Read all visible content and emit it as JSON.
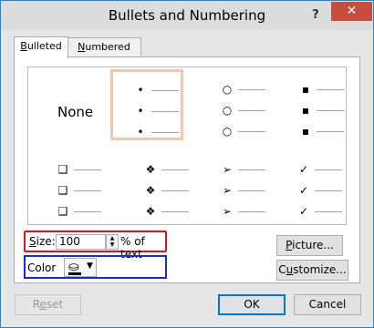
{
  "window": {
    "title": "Bullets and Numbering",
    "help_glyph": "?",
    "close_glyph": "✕"
  },
  "tabs": [
    {
      "label_prefix": "B",
      "label_rest": "ulleted",
      "active": true
    },
    {
      "label_prefix": "N",
      "label_rest": "umbered",
      "active": false
    }
  ],
  "gallery": {
    "none_label": "None",
    "styles": [
      {
        "name": "none",
        "glyph": ""
      },
      {
        "name": "filled-round",
        "glyph": "•"
      },
      {
        "name": "hollow-round",
        "glyph": "○"
      },
      {
        "name": "filled-square",
        "glyph": "▪"
      },
      {
        "name": "hollow-square",
        "glyph": "❑"
      },
      {
        "name": "star-diamond",
        "glyph": "❖"
      },
      {
        "name": "arrow",
        "glyph": "➢"
      },
      {
        "name": "checkmark",
        "glyph": "✓"
      }
    ],
    "selected": "filled-round"
  },
  "size": {
    "label_prefix": "S",
    "label_rest": "ize:",
    "value": "100",
    "suffix": "% of text"
  },
  "color": {
    "label": "Color",
    "current": "#000000"
  },
  "buttons": {
    "picture_prefix": "P",
    "picture_rest": "icture...",
    "customize_pre": "C",
    "customize_u": "u",
    "customize_rest": "stomize...",
    "reset_pre": "R",
    "reset_u": "e",
    "reset_rest": "set",
    "ok": "OK",
    "cancel": "Cancel"
  }
}
